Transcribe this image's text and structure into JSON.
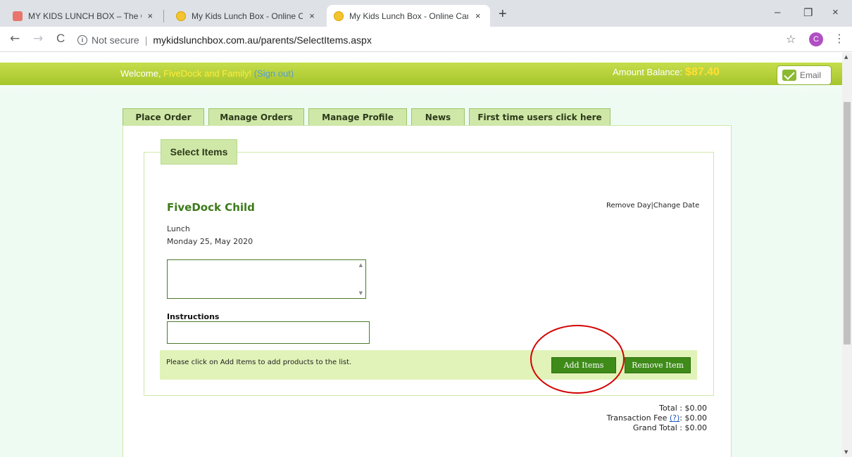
{
  "browser": {
    "tabs": [
      {
        "title": "MY KIDS LUNCH BOX – The Cante",
        "close": "×"
      },
      {
        "title": "My Kids Lunch Box - Online Cante",
        "close": "×"
      },
      {
        "title": "My Kids Lunch Box - Online Cante",
        "close": "×",
        "active": true
      }
    ],
    "new_tab": "+",
    "window_controls": {
      "minimize": "–",
      "restore": "❐",
      "close": "×"
    },
    "nav": {
      "back": "←",
      "forward": "→",
      "reload": "C"
    },
    "address": {
      "security": "Not secure",
      "separator": "|",
      "url": "mykidslunchbox.com.au/parents/SelectItems.aspx"
    },
    "bookmark_icon": "☆",
    "profile_initial": "C",
    "menu_icon": "⋮"
  },
  "header": {
    "welcome_prefix": "Welcome, ",
    "user_name": "FiveDock and Family!",
    "signout": "(Sign out)",
    "balance_label": "Amount Balance:",
    "balance_value": "$87.40",
    "email_button": "Email"
  },
  "tabs": [
    {
      "label": "Place Order"
    },
    {
      "label": "Manage Orders"
    },
    {
      "label": "Manage Profile"
    },
    {
      "label": "News"
    },
    {
      "label": "First time users click here"
    }
  ],
  "section": {
    "title": "Select Items",
    "child_name": "FiveDock Child",
    "remove_day": "Remove Day",
    "link_sep": "|",
    "change_date": "Change Date",
    "meal": "Lunch",
    "date": "Monday 25, May 2020",
    "instructions_label": "Instructions",
    "hint": "Please click on Add Items to add products to the list.",
    "add_items": "Add Items",
    "remove_item": "Remove Item"
  },
  "totals": {
    "total_label": "Total :",
    "total_value": "$0.00",
    "fee_label": "Transaction Fee",
    "fee_help": "(?)",
    "fee_colon": ":",
    "fee_value": "$0.00",
    "grand_label": "Grand Total :",
    "grand_value": "$0.00"
  },
  "colors": {
    "header_green": "#a6c52c",
    "button_green": "#3f8b1a",
    "annotation_red": "#d40000",
    "balance_yellow": "#ffe033"
  }
}
